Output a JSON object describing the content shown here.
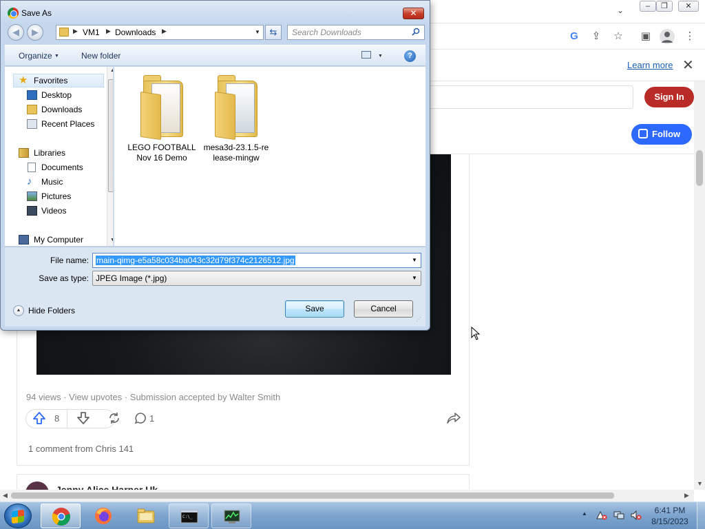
{
  "browser": {
    "infobar": {
      "learn_more": "Learn more"
    },
    "header": {
      "sign_in": "Sign In",
      "follow": "Follow"
    },
    "post": {
      "meta": "94 views · View upvotes · Submission accepted by Walter Smith",
      "upvotes": "8",
      "comments": "1",
      "comment_summary": "1 comment from Chris 141"
    },
    "next_post": {
      "author": "Jenny Alice Harper Uk"
    }
  },
  "dialog": {
    "title": "Save As",
    "breadcrumb": [
      "VM1",
      "Downloads"
    ],
    "search_placeholder": "Search Downloads",
    "toolbar": {
      "organize": "Organize",
      "new_folder": "New folder"
    },
    "nav": {
      "favorites": "Favorites",
      "desktop": "Desktop",
      "downloads": "Downloads",
      "recent_places": "Recent Places",
      "libraries": "Libraries",
      "documents": "Documents",
      "music": "Music",
      "pictures": "Pictures",
      "videos": "Videos",
      "my_computer": "My Computer"
    },
    "files": [
      {
        "line1": "LEGO FOOTBALL",
        "line2": "Nov 16 Demo"
      },
      {
        "line1": "mesa3d-23.1.5-re",
        "line2": "lease-mingw"
      }
    ],
    "file_name_label": "File name:",
    "file_name_value": "main-qimg-e5a58c034ba043c32d79f374c2126512.jpg",
    "save_as_type_label": "Save as type:",
    "save_as_type_value": "JPEG Image (*.jpg)",
    "hide_folders": "Hide Folders",
    "save": "Save",
    "cancel": "Cancel"
  },
  "taskbar": {
    "apps": [
      "chrome-icon",
      "firefox-icon",
      "file-explorer-icon",
      "command-prompt-icon",
      "task-manager-icon"
    ],
    "clock": {
      "time": "6:41 PM",
      "date": "8/15/2023"
    }
  },
  "colors": {
    "sign_in": "#b92b27",
    "follow": "#2e69ff",
    "selection": "#3399ff",
    "dialog_frame": "#c5d7ec"
  }
}
